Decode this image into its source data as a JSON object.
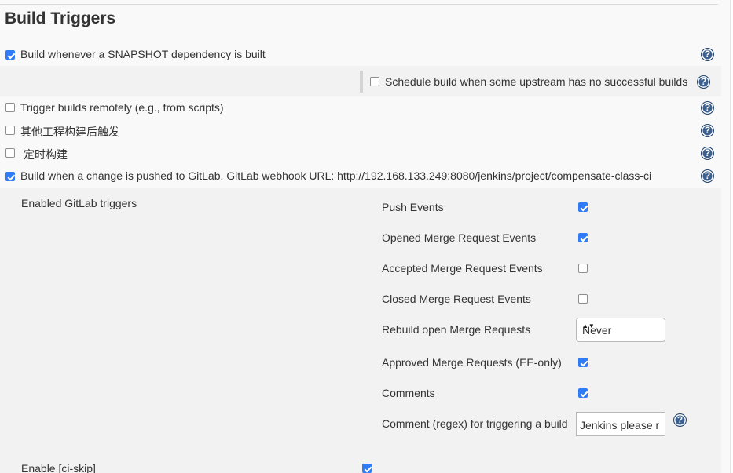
{
  "section": {
    "title": "Build Triggers"
  },
  "triggers": {
    "snapshot": {
      "label": "Build whenever a SNAPSHOT dependency is built",
      "checked": true
    },
    "upstream_no_success": {
      "label": "Schedule build when some upstream has no successful builds",
      "checked": false
    },
    "remote": {
      "label": "Trigger builds remotely (e.g., from scripts)",
      "checked": false
    },
    "after_other_projects": {
      "label": "其他工程构建后触发",
      "checked": false
    },
    "timed": {
      "label": "定时构建",
      "checked": false
    },
    "gitlab_push": {
      "label": "Build when a change is pushed to GitLab. GitLab webhook URL: http://192.168.133.249:8080/jenkins/project/compensate-class-ci",
      "checked": true
    }
  },
  "gitlab": {
    "enabled_triggers_label": "Enabled GitLab triggers",
    "push_events": {
      "label": "Push Events",
      "checked": true
    },
    "opened_mr_events": {
      "label": "Opened Merge Request Events",
      "checked": true
    },
    "accepted_mr_events": {
      "label": "Accepted Merge Request Events",
      "checked": false
    },
    "closed_mr_events": {
      "label": "Closed Merge Request Events",
      "checked": false
    },
    "rebuild_open_mr": {
      "label": "Rebuild open Merge Requests",
      "selected": "Never"
    },
    "approved_mr": {
      "label": "Approved Merge Requests (EE-only)",
      "checked": true
    },
    "comments": {
      "label": "Comments",
      "checked": true
    },
    "comment_regex": {
      "label": "Comment (regex) for triggering a build",
      "value": "Jenkins please r"
    },
    "ci_skip": {
      "label": "Enable [ci-skip]",
      "checked": true
    }
  },
  "icons": {
    "help": "help-icon",
    "help_glyph": "?",
    "select_arrows": "▲▼"
  },
  "colors": {
    "checkbox_checked": "#2f7cf6",
    "help_icon": "#3b5f8f"
  }
}
